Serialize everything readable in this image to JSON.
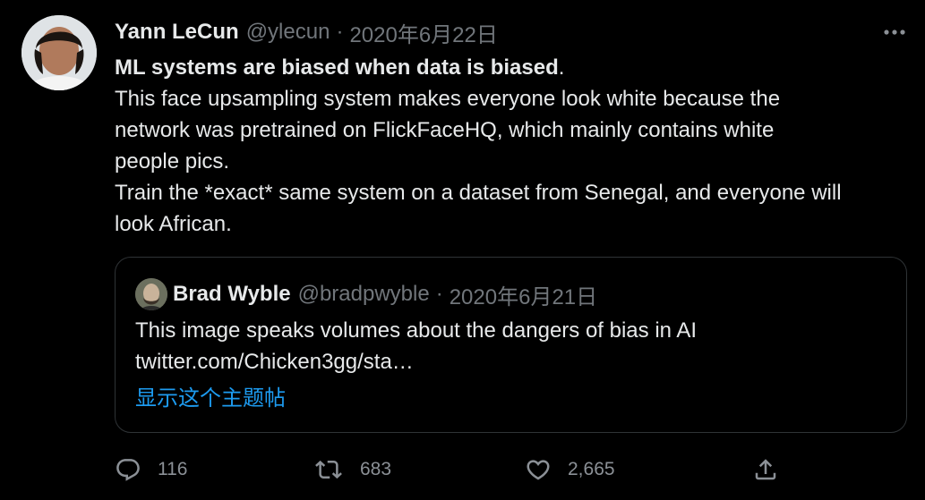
{
  "tweet": {
    "author_name": "Yann LeCun",
    "author_handle": "@ylecun",
    "separator": "·",
    "timestamp": "2020年6月22日",
    "body": {
      "bold_line": "ML systems are biased when data is biased",
      "bold_line_suffix": ".",
      "line_1": "This face upsampling system makes everyone look white because the",
      "line_2": "network was pretrained on FlickFaceHQ, which mainly contains white",
      "line_3": "people pics.",
      "line_4": "Train the *exact* same system on a dataset from Senegal, and everyone will",
      "line_5": "look African."
    },
    "more_icon": "ellipsis-icon"
  },
  "quoted_tweet": {
    "author_name": "Brad Wyble",
    "author_handle": "@bradpwyble",
    "separator": "·",
    "timestamp": "2020年6月21日",
    "text": "This image speaks volumes about the dangers of bias in AI",
    "link": "twitter.com/Chicken3gg/sta…",
    "show_thread": "显示这个主题帖"
  },
  "actions": {
    "reply": {
      "icon": "reply-icon",
      "count": "116"
    },
    "retweet": {
      "icon": "retweet-icon",
      "count": "683"
    },
    "like": {
      "icon": "heart-icon",
      "count": "2,665"
    },
    "share": {
      "icon": "share-icon"
    }
  },
  "colors": {
    "background": "#000000",
    "text": "#e7e9ea",
    "secondary": "#71767b",
    "link": "#1d9bf0",
    "border": "#2f3336"
  }
}
